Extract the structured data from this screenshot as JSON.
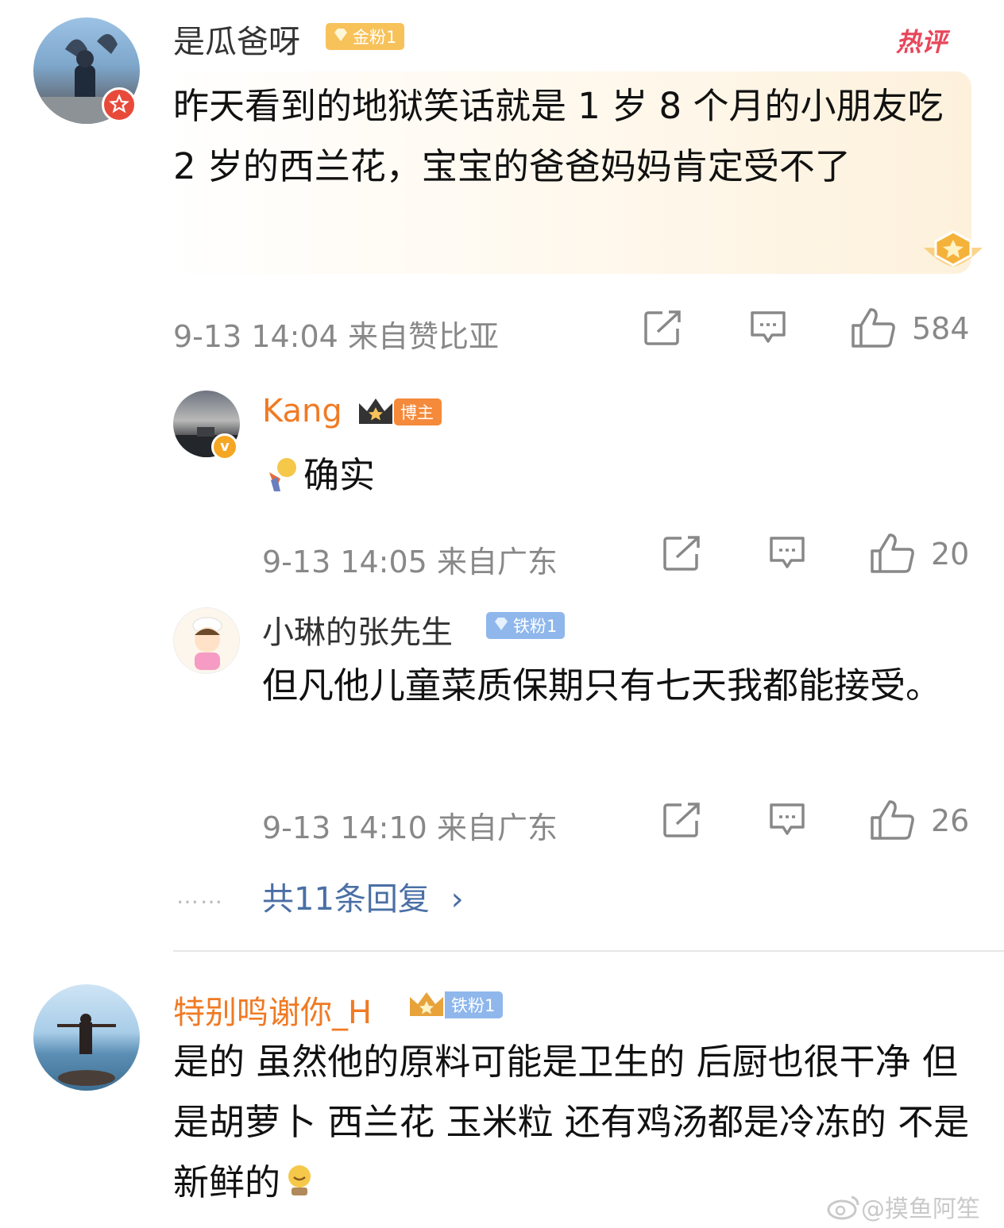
{
  "comment1": {
    "username": "是瓜爸呀",
    "badge": "金粉1",
    "hot_label": "热评",
    "text": "昨天看到的地狱笑话就是 1 岁 8 个月的小朋友吃 2 岁的西兰花，宝宝的爸爸妈妈肯定受不了",
    "time": "9-13 14:04",
    "location": "来自赞比亚",
    "likes": "584"
  },
  "reply1": {
    "username": "Kang",
    "badge": "博主",
    "text": "确实",
    "time": "9-13 14:05",
    "location": "来自广东",
    "likes": "20"
  },
  "reply2": {
    "username": "小琳的张先生",
    "badge": "铁粉1",
    "text": "但凡他儿童菜质保期只有七天我都能接受。",
    "time": "9-13 14:10",
    "location": "来自广东",
    "likes": "26"
  },
  "more_replies": {
    "dots": "……",
    "label": "共11条回复",
    "chevron": "›"
  },
  "comment2": {
    "username": "特别鸣谢你_H",
    "badge": "铁粉1",
    "text": "是的 虽然他的原料可能是卫生的 后厨也很干净 但是胡萝卜 西兰花 玉米粒 还有鸡汤都是冷冻的 不是新鲜的"
  },
  "watermark": "@摸鱼阿笙",
  "icons": {
    "share": "share-icon",
    "comment": "comment-icon",
    "like": "thumbs-up-icon"
  },
  "colors": {
    "orange_name": "#f07a24",
    "link_blue": "#4a6fa5",
    "hot_red": "#e8465a",
    "meta_gray": "#888888"
  }
}
